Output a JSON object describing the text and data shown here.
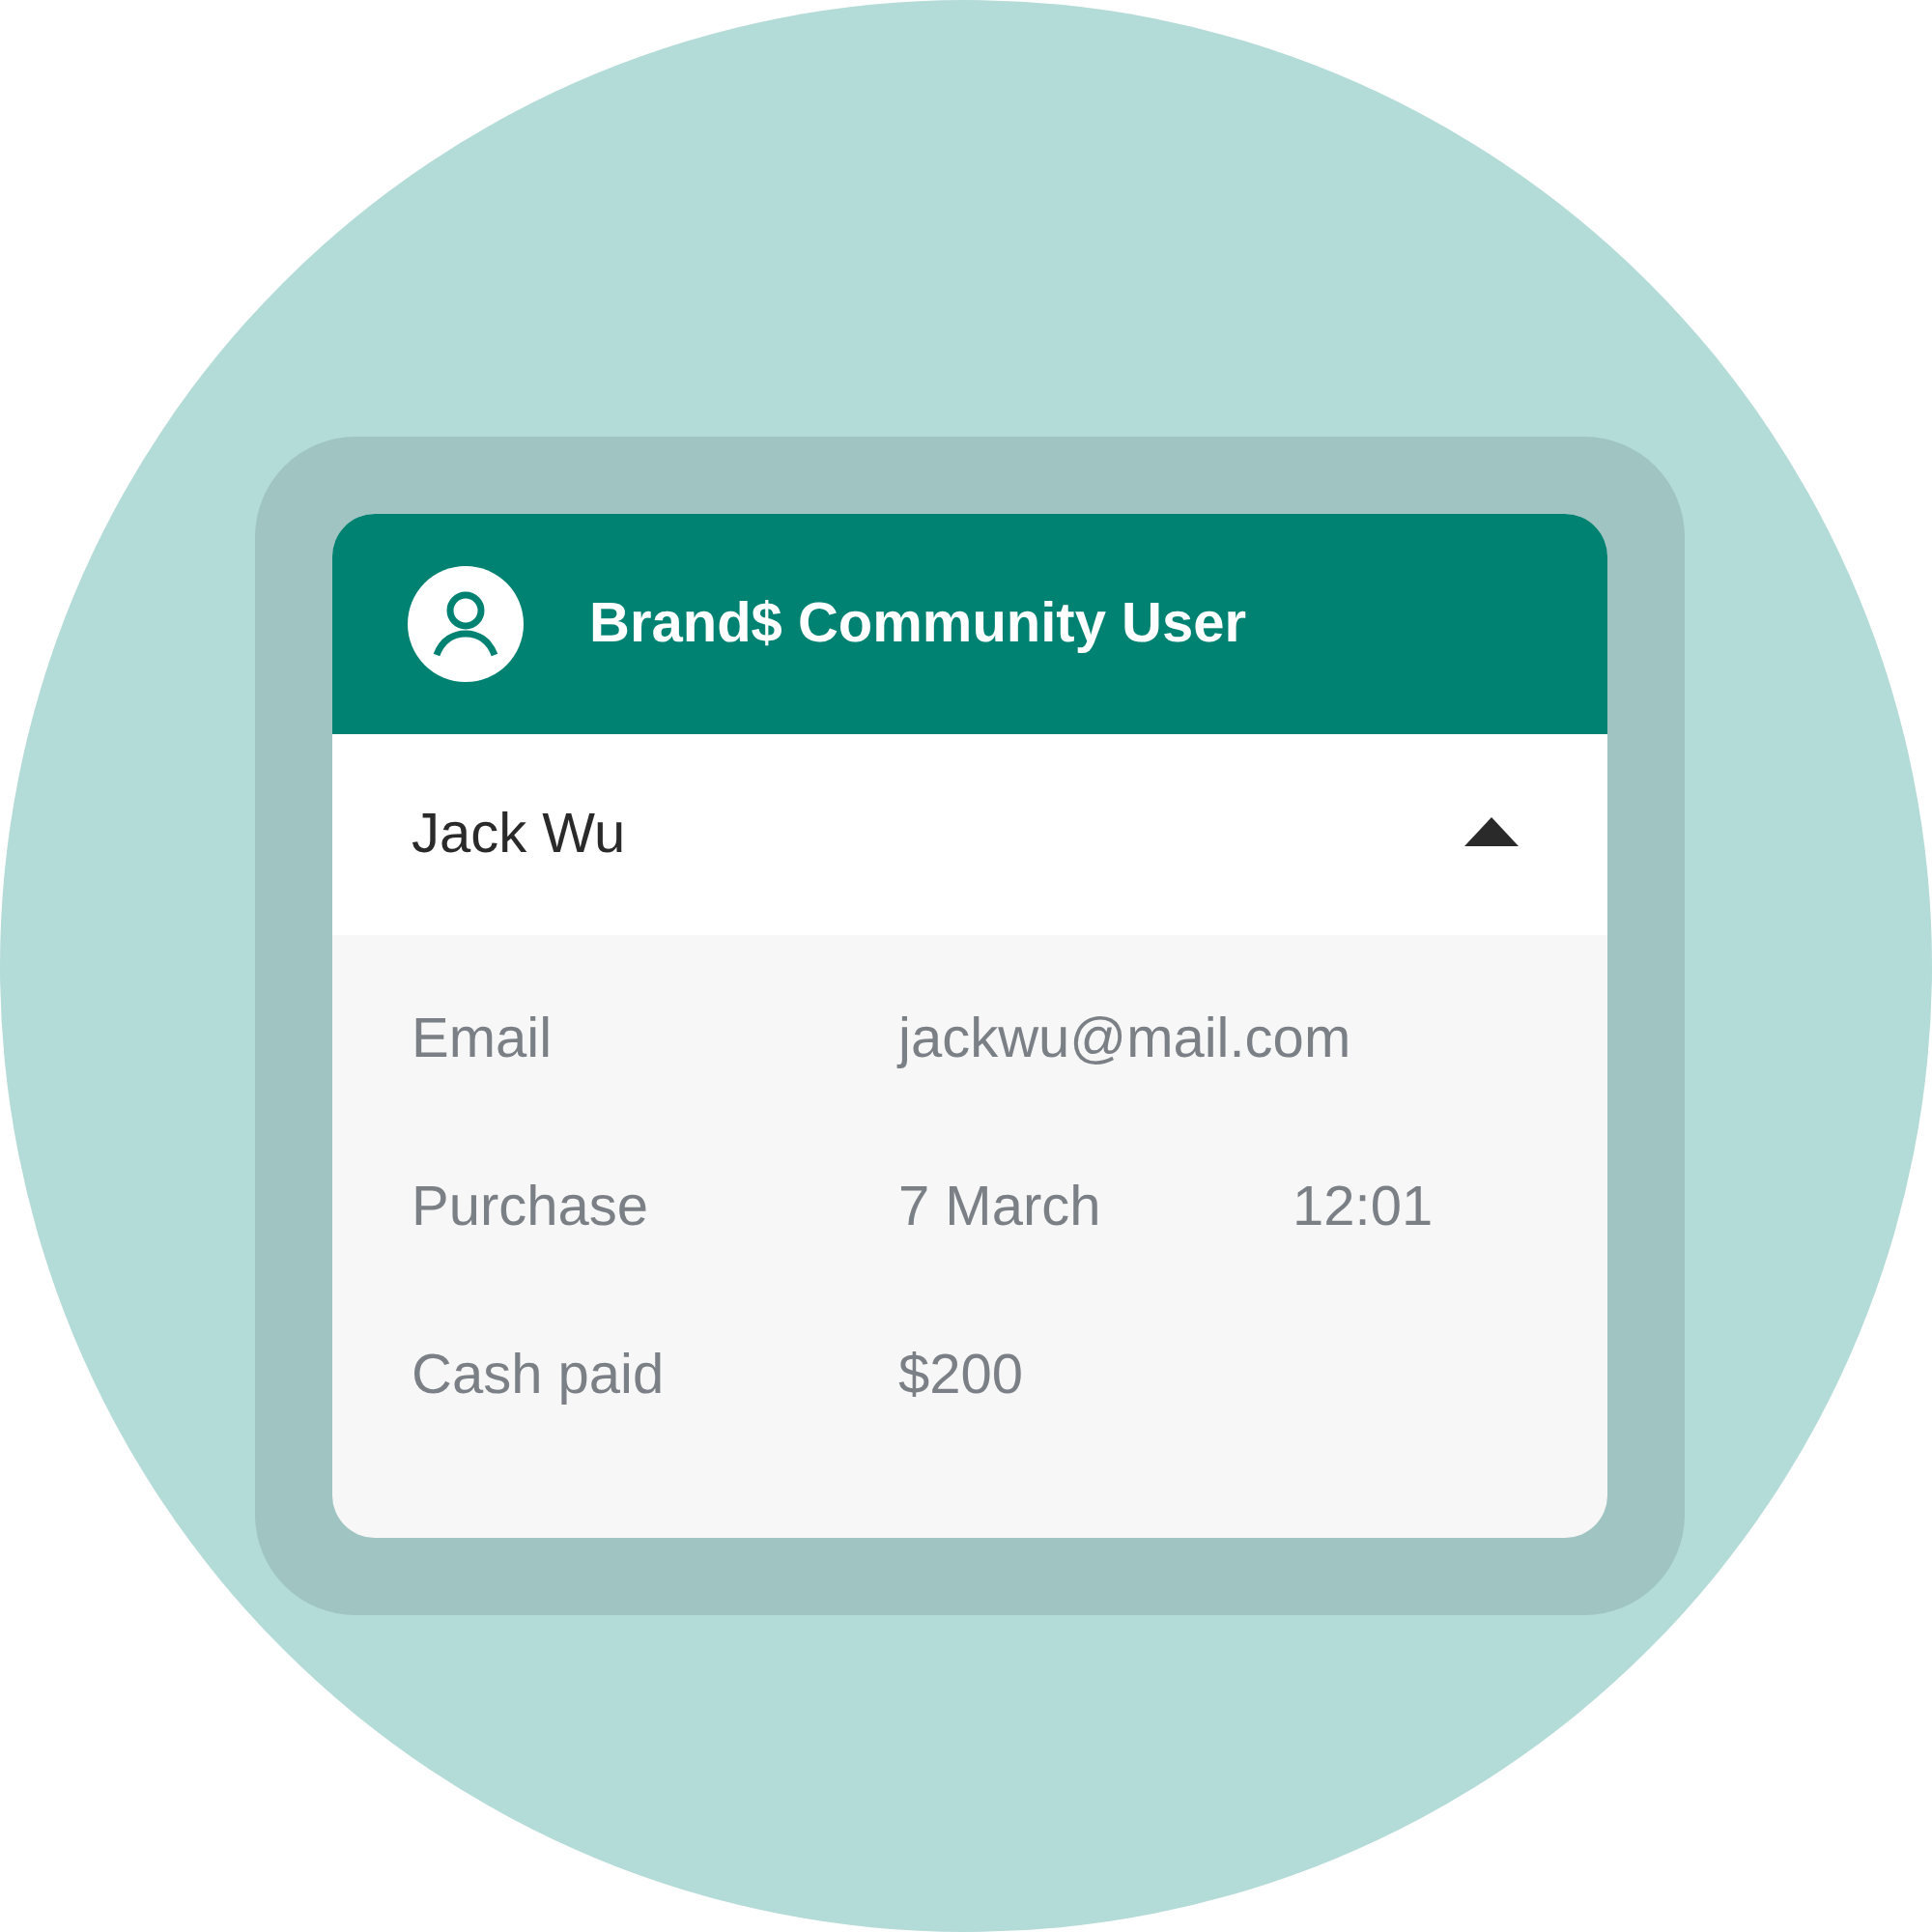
{
  "card": {
    "title": "Brand$ Community User",
    "user": {
      "name": "Jack Wu",
      "expanded": true
    },
    "details": [
      {
        "label": "Email",
        "values": [
          "jackwu@mail.com"
        ]
      },
      {
        "label": "Purchase",
        "values": [
          "7 March",
          "12:01"
        ]
      },
      {
        "label": "Cash paid",
        "values": [
          "$200"
        ]
      }
    ]
  }
}
